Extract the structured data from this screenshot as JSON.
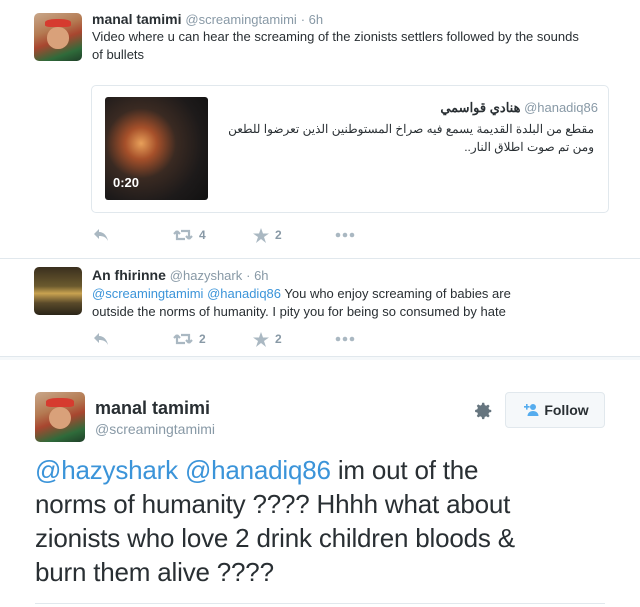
{
  "tweet1": {
    "name": "manal tamimi",
    "handle": "@screamingtamimi",
    "time": "· 6h",
    "text": "Video where u can hear the screaming of the zionists settlers followed by the sounds of bullets",
    "quoted": {
      "name": "هنادي قواسمي",
      "handle": "@hanadiq86",
      "text": "مقطع من البلدة القديمة يسمع فيه صراخ المستوطنين الذين تعرضوا للطعن ومن تم صوت اطلاق النار..",
      "video_duration": "0:20"
    },
    "retweets": "4",
    "favorites": "2"
  },
  "tweet2": {
    "name": "An fhirinne",
    "handle": "@hazyshark",
    "time": "· 6h",
    "mention1": "@screamingtamimi",
    "mention2": "@hanadiq86",
    "text_line1_rest": " You who enjoy screaming of babies are",
    "text_line2": "outside the norms of humanity. I pity you for being so consumed by hate",
    "retweets": "2",
    "favorites": "2"
  },
  "expanded": {
    "name": "manal tamimi",
    "handle": "@screamingtamimi",
    "follow_label": "Follow",
    "mention1": "@hazyshark",
    "mention2": "@hanadiq86",
    "text_line1_rest": " im out of the",
    "text_line2": "norms of humanity ???? Hhhh what about",
    "text_line3": "zionists who love 2 drink children bloods &",
    "text_line4": "burn them alive ????"
  },
  "icons": {
    "reply": "reply-icon",
    "retweet": "retweet-icon",
    "favorite": "star-icon",
    "more": "more-icon",
    "gear": "gear-icon",
    "follow": "add-user-icon"
  },
  "colors": {
    "link": "#3b94d9",
    "muted": "#8899a6",
    "icon": "#aab8c2"
  }
}
